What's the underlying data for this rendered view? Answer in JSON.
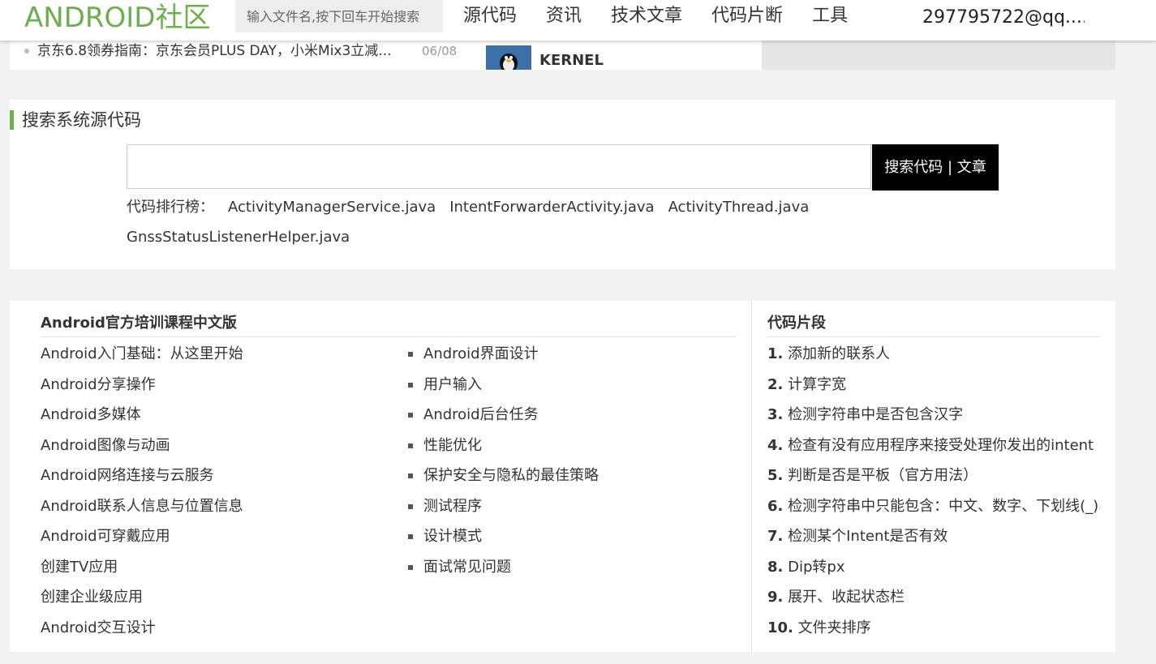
{
  "header": {
    "logo": "ANDROID社区",
    "search_placeholder": "输入文件名,按下回车开始搜索",
    "nav": [
      "源代码",
      "资讯",
      "技术文章",
      "代码片断",
      "工具"
    ],
    "user": "297795722@qq...."
  },
  "news": {
    "item": "京东6.8领券指南：京东会员PLUS DAY，小米Mix3立减...",
    "date": "06/08",
    "kernel_label": "KERNEL"
  },
  "search_section": {
    "title": "搜索系统源代码",
    "button_label": "搜索代码 | 文章",
    "ranking_label": "代码排行榜：",
    "ranking_files": [
      "ActivityManagerService.java",
      "IntentForwarderActivity.java",
      "ActivityThread.java",
      "GnssStatusListenerHelper.java"
    ]
  },
  "training": {
    "title": "Android官方培训课程中文版",
    "left": [
      "Android入门基础：从这里开始",
      "Android分享操作",
      "Android多媒体",
      "Android图像与动画",
      "Android网络连接与云服务",
      "Android联系人信息与位置信息",
      "Android可穿戴应用",
      "创建TV应用",
      "创建企业级应用",
      "Android交互设计"
    ],
    "right": [
      "Android界面设计",
      "用户输入",
      "Android后台任务",
      "性能优化",
      "保护安全与隐私的最佳策略",
      "测试程序",
      "设计模式",
      "面试常见问题"
    ]
  },
  "snippets": {
    "title": "代码片段",
    "items": [
      {
        "num": "1.",
        "text": "添加新的联系人"
      },
      {
        "num": "2.",
        "text": "计算字宽"
      },
      {
        "num": "3.",
        "text": "检测字符串中是否包含汉字"
      },
      {
        "num": "4.",
        "text": "检查有没有应用程序来接受处理你发出的intent"
      },
      {
        "num": "5.",
        "text": "判断是否是平板（官方用法）"
      },
      {
        "num": "6.",
        "text": "检测字符串中只能包含：中文、数字、下划线(_)、横线(-)"
      },
      {
        "num": "7.",
        "text": "检测某个Intent是否有效"
      },
      {
        "num": "8.",
        "text": "Dip转px"
      },
      {
        "num": "9.",
        "text": "展开、收起状态栏"
      },
      {
        "num": "10.",
        "text": "文件夹排序"
      }
    ]
  },
  "colors": {
    "accent": "#6ab04c",
    "button_bg": "#000000",
    "page_bg": "#f2f2f2"
  }
}
